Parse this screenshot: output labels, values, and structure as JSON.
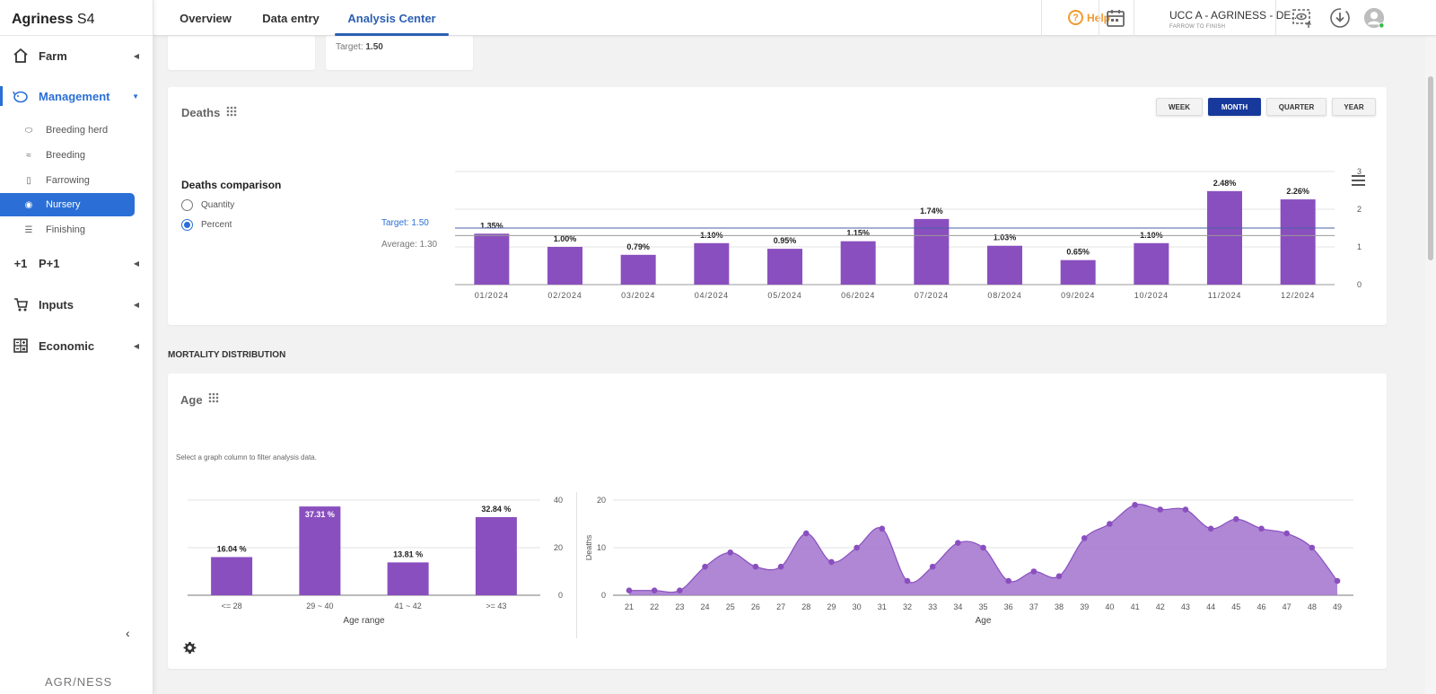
{
  "app": {
    "brand": "Agriness",
    "brand_suffix": "S4",
    "footer_logo": "AGR/NESS"
  },
  "sidebar": {
    "groups": [
      {
        "label": "Farm",
        "icon": "house-icon"
      },
      {
        "label": "Management",
        "icon": "piggy-icon"
      },
      {
        "label": "P+1",
        "icon": "plus-one-icon"
      },
      {
        "label": "Inputs",
        "icon": "cart-icon"
      },
      {
        "label": "Economic",
        "icon": "calculator-icon"
      }
    ],
    "management_items": [
      {
        "label": "Breeding herd",
        "icon": "pig-icon"
      },
      {
        "label": "Breeding",
        "icon": "mating-icon"
      },
      {
        "label": "Farrowing",
        "icon": "bottle-icon"
      },
      {
        "label": "Nursery",
        "icon": "piglet-icon"
      },
      {
        "label": "Finishing",
        "icon": "pen-icon"
      }
    ]
  },
  "topbar": {
    "tabs": [
      "Overview",
      "Data entry",
      "Analysis Center"
    ],
    "active_tab": "Analysis Center",
    "help_label": "Help",
    "farm_name": "UCC A - AGRINESS - DE...",
    "farm_type": "FARROW TO FINISH"
  },
  "top_card": {
    "target_label": "Target:",
    "target_value": "1.50"
  },
  "deaths": {
    "title": "Deaths",
    "periods": [
      "WEEK",
      "MONTH",
      "QUARTER",
      "YEAR"
    ],
    "active_period": "MONTH",
    "comparison_title": "Deaths comparison",
    "options": [
      "Quantity",
      "Percent"
    ],
    "selected_option": "Percent",
    "target_legend": "Target: 1.50",
    "average_legend": "Average: 1.30"
  },
  "mortality": {
    "section_title": "MORTALITY DISTRIBUTION",
    "age_title": "Age",
    "hint": "Select a graph column to filter analysis data."
  },
  "colors": {
    "bar": "#8a4fbf",
    "area": "#a67ad0",
    "accent": "#2b6fd6",
    "active_button": "#17399b",
    "help": "#f29a2e"
  },
  "chart_data": [
    {
      "type": "bar",
      "categories": [
        "01/2024",
        "02/2024",
        "03/2024",
        "04/2024",
        "05/2024",
        "06/2024",
        "07/2024",
        "08/2024",
        "09/2024",
        "10/2024",
        "11/2024",
        "12/2024"
      ],
      "values": [
        1.35,
        1.0,
        0.79,
        1.1,
        0.95,
        1.15,
        1.74,
        1.03,
        0.65,
        1.1,
        2.48,
        2.26
      ],
      "data_labels": [
        "1.35%",
        "1.00%",
        "0.79%",
        "1.10%",
        "0.95%",
        "1.15%",
        "1.74%",
        "1.03%",
        "0.65%",
        "1.10%",
        "2.48%",
        "2.26%"
      ],
      "ylim": [
        0,
        3
      ],
      "yticks": [
        0,
        1,
        2,
        3
      ],
      "reference_lines": {
        "target": 1.5,
        "average": 1.3
      },
      "grid": true,
      "axis_side": "right"
    },
    {
      "type": "bar",
      "categories": [
        "<= 28",
        "29 ~ 40",
        "41 ~ 42",
        ">= 43"
      ],
      "values": [
        16.04,
        37.31,
        13.81,
        32.84
      ],
      "data_labels": [
        "16.04 %",
        "37.31 %",
        "13.81 %",
        "32.84 %"
      ],
      "xlabel": "Age range",
      "ylim": [
        0,
        40
      ],
      "yticks": [
        0,
        20,
        40
      ],
      "grid": true,
      "axis_side": "right"
    },
    {
      "type": "area",
      "x": [
        21,
        22,
        23,
        24,
        25,
        26,
        27,
        28,
        29,
        30,
        31,
        32,
        33,
        34,
        35,
        36,
        37,
        38,
        39,
        40,
        41,
        42,
        43,
        44,
        45,
        46,
        47,
        48,
        49
      ],
      "values": [
        1,
        1,
        1,
        6,
        9,
        6,
        6,
        13,
        7,
        10,
        14,
        3,
        6,
        11,
        10,
        3,
        5,
        4,
        12,
        15,
        19,
        18,
        18,
        14,
        16,
        14,
        13,
        10,
        3
      ],
      "xlabel": "Age",
      "ylabel": "Deaths",
      "ylim": [
        0,
        20
      ],
      "yticks": [
        0,
        10,
        20
      ],
      "grid": true
    }
  ]
}
